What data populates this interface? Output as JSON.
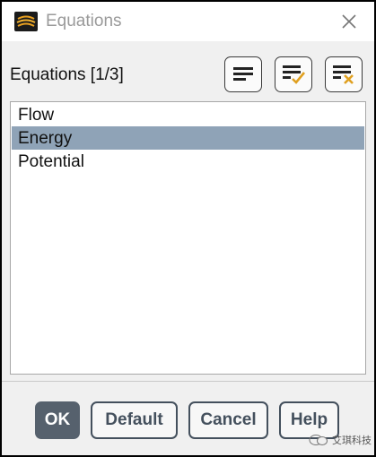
{
  "window": {
    "title": "Equations",
    "close_icon": "close-icon",
    "app_icon": "ansys-fluent-icon"
  },
  "header": {
    "label": "Equations  [1/3]",
    "tools": [
      {
        "name": "select-all-icon",
        "description": "list lines"
      },
      {
        "name": "select-checked-icon",
        "description": "list lines with check"
      },
      {
        "name": "deselect-all-icon",
        "description": "list lines with x"
      }
    ]
  },
  "equations_list": {
    "items": [
      {
        "label": "Flow",
        "selected": false
      },
      {
        "label": "Energy",
        "selected": true
      },
      {
        "label": "Potential",
        "selected": false
      }
    ]
  },
  "buttons": {
    "ok": "OK",
    "default": "Default",
    "cancel": "Cancel",
    "help": "Help"
  },
  "watermark": {
    "text": "艾琪科技"
  },
  "colors": {
    "selection": "#8fa3b7",
    "primary_button": "#56616d",
    "button_border": "#44505d",
    "check_accent": "#e0a020",
    "x_accent": "#e0a020"
  }
}
